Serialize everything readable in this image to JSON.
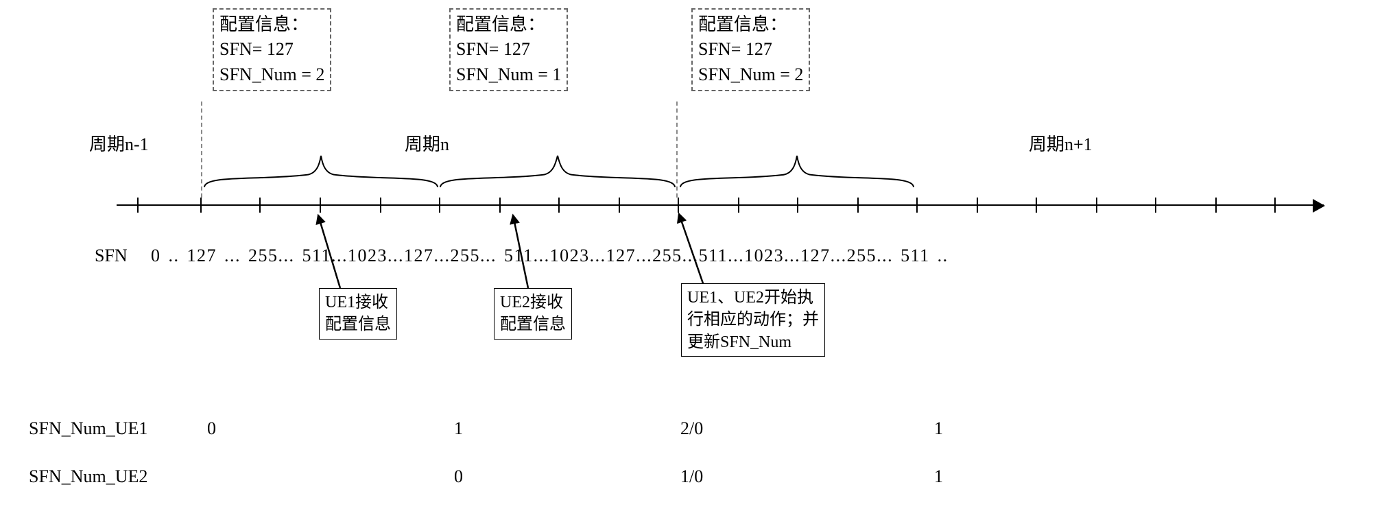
{
  "config_boxes": [
    {
      "title": "配置信息：",
      "line1": "SFN= 127",
      "line2": "SFN_Num = 2"
    },
    {
      "title": "配置信息：",
      "line1": "SFN= 127",
      "line2": "SFN_Num = 1"
    },
    {
      "title": "配置信息：",
      "line1": "SFN= 127",
      "line2": "SFN_Num = 2"
    }
  ],
  "periods": {
    "pminus1": "周期n-1",
    "p": "周期n",
    "pplus1": "周期n+1"
  },
  "sfn_label": "SFN",
  "sfn_strip": "0 .. 127 ... 255... 511...1023...127...255... 511...1023...127...255...511...1023...127...255... 511 ..",
  "events": {
    "ue1": {
      "line1": "UE1接收",
      "line2": "配置信息"
    },
    "ue2": {
      "line1": "UE2接收",
      "line2": "配置信息"
    },
    "both": {
      "line1": "UE1、UE2开始执",
      "line2": "行相应的动作；并",
      "line3": "更新SFN_Num"
    }
  },
  "rows": {
    "r1_label": "SFN_Num_UE1",
    "r2_label": "SFN_Num_UE2",
    "r1_v0": "0",
    "r1_v1": "1",
    "r1_v2": "2/0",
    "r1_v3": "1",
    "r2_v0": "0",
    "r2_v1": "1/0",
    "r2_v2": "1"
  }
}
